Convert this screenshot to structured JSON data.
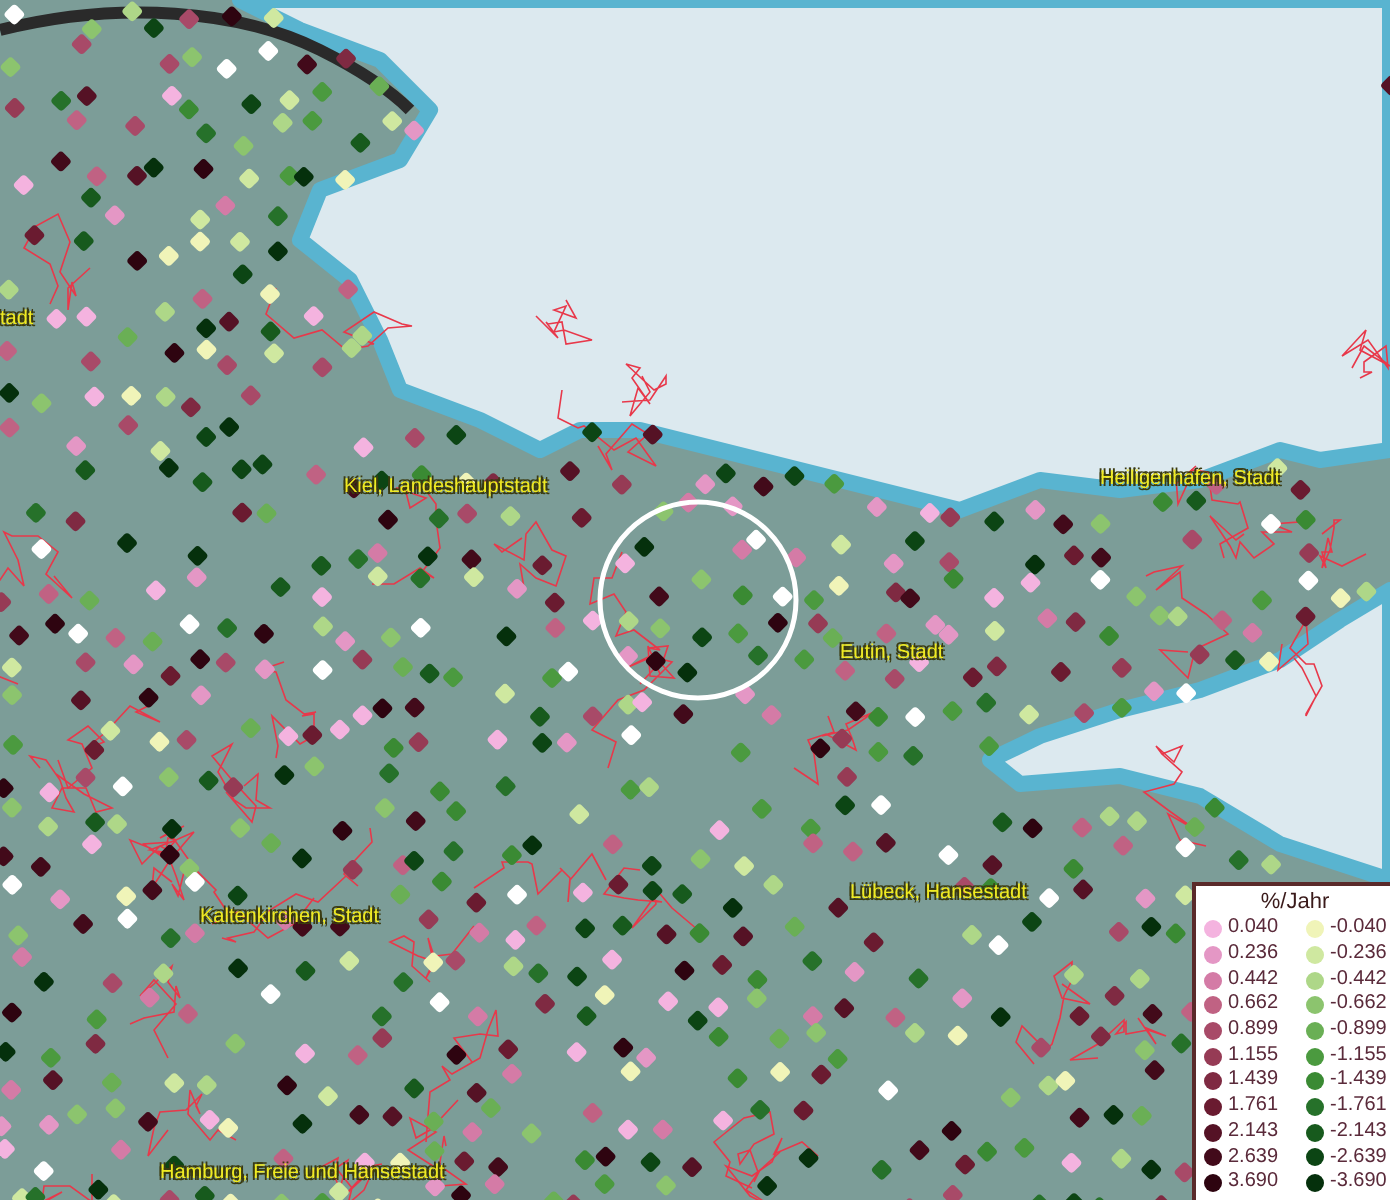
{
  "place_labels": [
    {
      "text": "tadt"
    },
    {
      "text": "Kiel, Landeshauptstadt"
    },
    {
      "text": "Heiligenhafen, Stadt"
    },
    {
      "text": "Eutin, Stadt"
    },
    {
      "text": "Kaltenkirchen, Stadt"
    },
    {
      "text": "Lübeck, Hansestadt"
    },
    {
      "text": "Hamburg, Freie und Hansestadt"
    }
  ],
  "legend": {
    "title": "%/Jahr",
    "rows": [
      {
        "positive": {
          "label": "0.040",
          "color": "#f4b3df"
        },
        "negative": {
          "label": "-0.040",
          "color": "#f0f4b8"
        }
      },
      {
        "positive": {
          "label": "0.236",
          "color": "#e497c5"
        },
        "negative": {
          "label": "-0.236",
          "color": "#cfe8a0"
        }
      },
      {
        "positive": {
          "label": "0.442",
          "color": "#d47ba6"
        },
        "negative": {
          "label": "-0.442",
          "color": "#aed788"
        }
      },
      {
        "positive": {
          "label": "0.662",
          "color": "#c06283"
        },
        "negative": {
          "label": "-0.662",
          "color": "#8cc46e"
        }
      },
      {
        "positive": {
          "label": "0.899",
          "color": "#a84a68"
        },
        "negative": {
          "label": "-0.899",
          "color": "#6aaf55"
        }
      },
      {
        "positive": {
          "label": "1.155",
          "color": "#963b55"
        },
        "negative": {
          "label": "-1.155",
          "color": "#4b9a3f"
        }
      },
      {
        "positive": {
          "label": "1.439",
          "color": "#7f2a42"
        },
        "negative": {
          "label": "-1.439",
          "color": "#3a8a33"
        }
      },
      {
        "positive": {
          "label": "1.761",
          "color": "#6a1b30"
        },
        "negative": {
          "label": "-1.761",
          "color": "#26712a"
        }
      },
      {
        "positive": {
          "label": "2.143",
          "color": "#551225"
        },
        "negative": {
          "label": "-2.143",
          "color": "#175a1d"
        }
      },
      {
        "positive": {
          "label": "2.639",
          "color": "#420a1a"
        },
        "negative": {
          "label": "-2.639",
          "color": "#0c4514"
        }
      },
      {
        "positive": {
          "label": "3.690",
          "color": "#2e0410"
        },
        "negative": {
          "label": "-3.690",
          "color": "#05300c"
        }
      }
    ]
  }
}
